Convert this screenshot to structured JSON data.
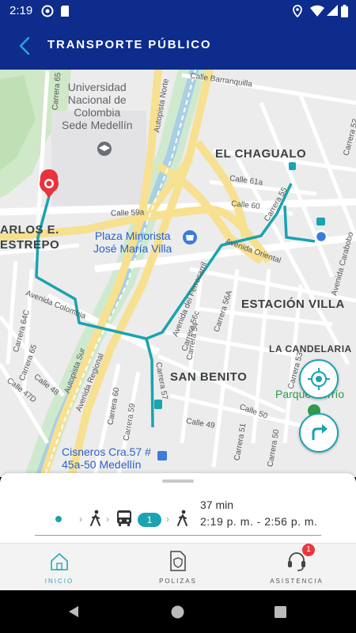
{
  "status_bar": {
    "time": "2:19"
  },
  "app_bar": {
    "title": "TRANSPORTE PÚBLICO"
  },
  "map": {
    "streets": [
      "Calle Barranquilla",
      "Carrera 65",
      "Autopista Norte",
      "Calle 61a",
      "Calle 60",
      "Calle 59a",
      "Carrera 55",
      "Avenida Oriental",
      "Avenida Carabobo",
      "Carrera 52",
      "Carrera 53",
      "Avenida del Ferrocarril",
      "Carrera 56A",
      "Carrera 56c",
      "Avenida Colombia",
      "Carrera 64C",
      "Carrera 65",
      "Calle 48",
      "Calle 47D",
      "Autopista Sur",
      "Avenida Regional",
      "Carrera 57",
      "Carrera 60",
      "Carrera 59",
      "Calle 49",
      "Calle 50",
      "Carrera 50",
      "Carrera 51",
      "Carrera 54"
    ],
    "neighborhoods": [
      "EL CHAGUALO",
      "ESTACIÓN VILLA",
      "LA CANDELARIA",
      "SAN BENITO",
      "ARLOS E.",
      "ESTREPO"
    ],
    "pois": {
      "university": "Universidad\nNacional de\nColombia\nSede Medellín",
      "plaza": "Plaza Minorista\nJosé María Villa",
      "parque": "Parque Berrío",
      "cisneros": "Cisneros Cra.57 #\n45a-50 Medellín"
    }
  },
  "route": {
    "duration": "37 min",
    "time_range": "2:19 p. m. - 2:56 p. m.",
    "bus_number": "1"
  },
  "bottom_nav": {
    "items": [
      {
        "label": "INICIO",
        "icon": "home-icon",
        "active": true
      },
      {
        "label": "POLIZAS",
        "icon": "policy-document-icon",
        "active": false
      },
      {
        "label": "ASISTENCIA",
        "icon": "headset-icon",
        "active": false,
        "badge": "1"
      }
    ]
  },
  "colors": {
    "primary": "#0d2c8c",
    "accent": "#1aa3b0",
    "marker": "#e8323c",
    "badge": "#e8383d"
  }
}
